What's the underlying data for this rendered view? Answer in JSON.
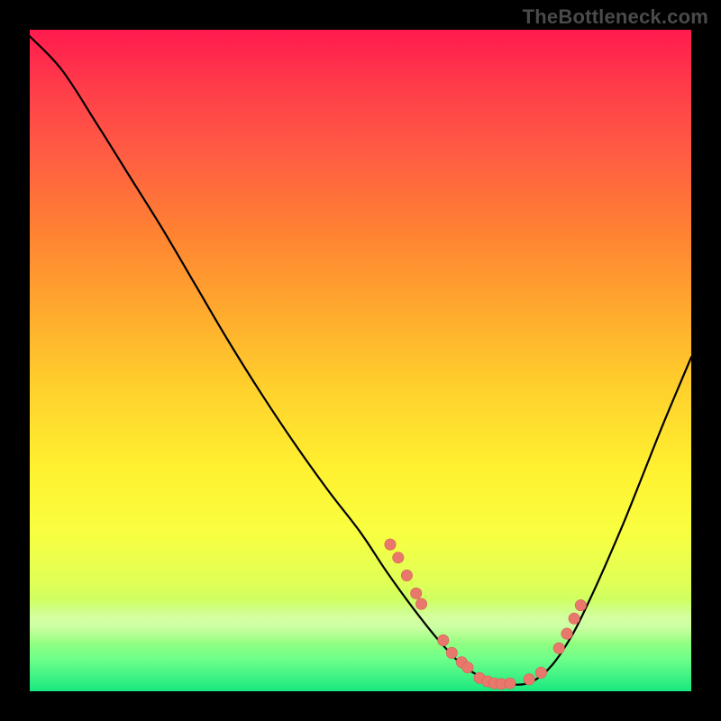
{
  "watermark": {
    "text": "TheBottleneck.com"
  },
  "colors": {
    "background": "#000000",
    "curve_stroke": "#000000",
    "point_fill": "#e8776c",
    "point_stroke": "#d85f55"
  },
  "chart_data": {
    "type": "line",
    "title": "",
    "xlabel": "",
    "ylabel": "",
    "xlim": [
      0,
      100
    ],
    "ylim": [
      0,
      100
    ],
    "grid": false,
    "legend": false,
    "notes": "Bottleneck-style V-curve on rainbow gradient background. No axis ticks or labels are visible. X positions and Y heights are read off the image as percentages of the 734×734 plot area (origin top-left, Y increases downward). Scatter points lie on/near the curve in the valley region.",
    "series": [
      {
        "name": "curve",
        "kind": "line",
        "x": [
          0.0,
          4.8,
          10.0,
          15.0,
          20.0,
          25.0,
          30.0,
          35.0,
          40.0,
          45.0,
          50.0,
          54.0,
          58.0,
          62.0,
          66.0,
          70.0,
          73.0,
          76.0,
          79.0,
          82.0,
          84.5,
          87.0,
          90.0,
          93.0,
          96.0,
          100.0
        ],
        "y": [
          1.0,
          6.0,
          14.0,
          22.0,
          30.0,
          38.5,
          47.0,
          55.0,
          62.5,
          69.5,
          76.0,
          82.0,
          87.5,
          92.5,
          96.5,
          98.5,
          99.0,
          98.5,
          96.0,
          91.5,
          86.5,
          81.0,
          74.0,
          66.5,
          59.0,
          49.5
        ]
      },
      {
        "name": "points",
        "kind": "scatter",
        "x": [
          54.5,
          55.7,
          57.0,
          58.4,
          59.2,
          62.5,
          63.8,
          65.3,
          66.2,
          68.0,
          69.2,
          70.2,
          71.3,
          72.6,
          75.5,
          77.3,
          80.0,
          81.2,
          82.3,
          83.3
        ],
        "y": [
          77.8,
          79.8,
          82.5,
          85.2,
          86.8,
          92.3,
          94.2,
          95.6,
          96.4,
          98.0,
          98.5,
          98.8,
          98.9,
          98.8,
          98.2,
          97.2,
          93.5,
          91.3,
          89.0,
          87.0
        ]
      }
    ]
  }
}
